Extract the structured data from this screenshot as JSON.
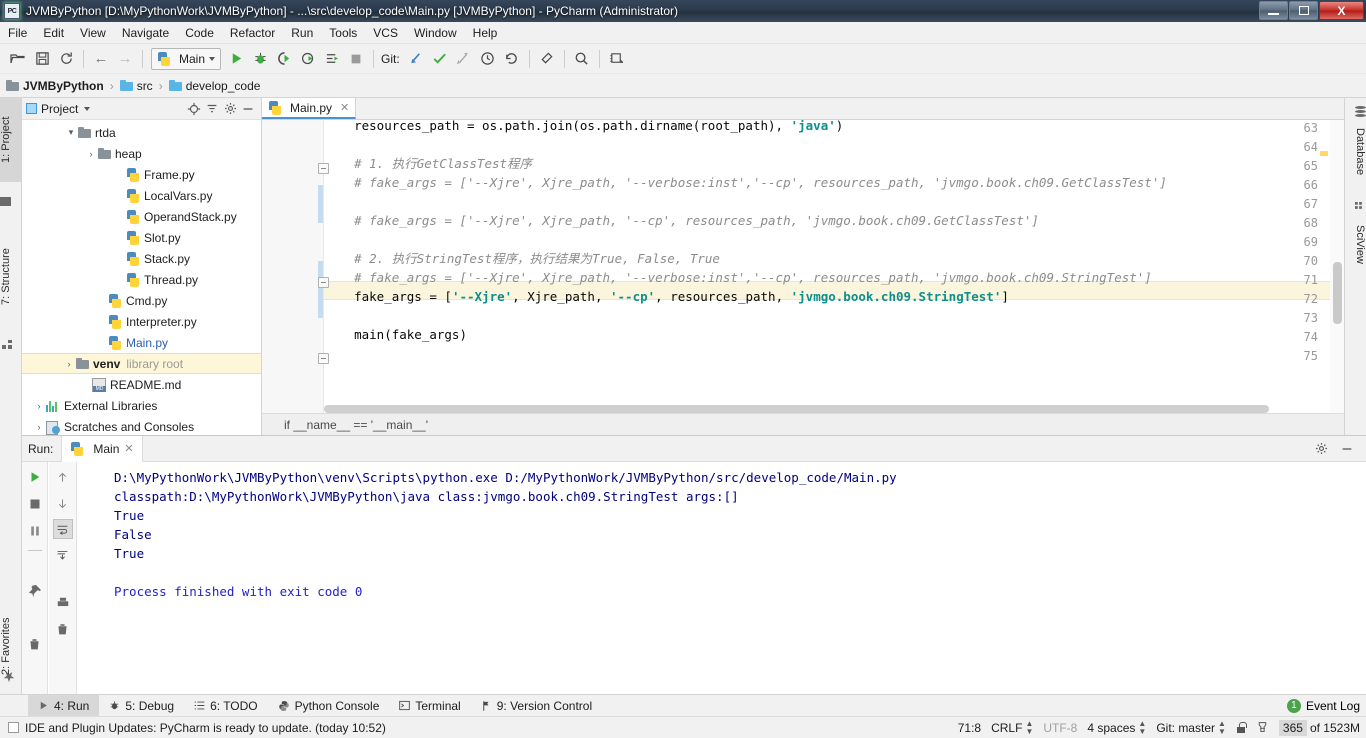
{
  "window": {
    "title": "JVMByPython [D:\\MyPythonWork\\JVMByPython] - ...\\src\\develop_code\\Main.py [JVMByPython] - PyCharm (Administrator)",
    "app_icon": "PC",
    "minimize": "–",
    "maximize": "❐",
    "close": "✕"
  },
  "menu": {
    "items": [
      "File",
      "Edit",
      "View",
      "Navigate",
      "Code",
      "Refactor",
      "Run",
      "Tools",
      "VCS",
      "Window",
      "Help"
    ]
  },
  "toolbar": {
    "open_label": "open-folder-icon",
    "save_label": "save-icon",
    "sync_label": "sync-icon",
    "back_label": "←",
    "forward_label": "→",
    "run_config": "Main",
    "run_label": "run-icon",
    "debug_label": "debug-icon",
    "coverage_label": "coverage-icon",
    "profile_label": "profile-icon",
    "rerun_label": "rerun-icon",
    "stop_label": "stop-icon",
    "git_label": "Git:",
    "update_label": "update-project-icon",
    "commit_label": "commit-icon",
    "push_label": "push-icon",
    "history_label": "history-icon",
    "revert_label": "revert-icon",
    "settings_label": "settings-icon",
    "search_label": "search-icon",
    "sdk_label": "sdk-icon"
  },
  "breadcrumb": {
    "items": [
      {
        "label": "JVMByPython",
        "kind": "project"
      },
      {
        "label": "src",
        "kind": "folder"
      },
      {
        "label": "develop_code",
        "kind": "folder"
      }
    ],
    "separator": "›"
  },
  "left_tool_strip": {
    "tabs": [
      {
        "label": "1: Project",
        "active": true
      },
      {
        "label": "7: Structure",
        "active": false
      },
      {
        "label": "2: Favorites",
        "active": false
      }
    ]
  },
  "right_tool_strip": {
    "tabs": [
      {
        "label": "Database"
      },
      {
        "label": "SciView"
      }
    ]
  },
  "project_panel": {
    "title": "Project",
    "buttons": [
      "locate-icon",
      "collapse-all-icon",
      "gear-icon",
      "hide-icon"
    ],
    "tree": [
      {
        "indent": 3,
        "arrow": "⌄",
        "icon": "folder",
        "label": "rtda",
        "selected": false
      },
      {
        "indent": 4,
        "arrow": "›",
        "icon": "folder",
        "label": "heap",
        "selected": false
      },
      {
        "indent": 5,
        "arrow": "",
        "icon": "python",
        "label": "Frame.py",
        "selected": false
      },
      {
        "indent": 5,
        "arrow": "",
        "icon": "python",
        "label": "LocalVars.py",
        "selected": false
      },
      {
        "indent": 5,
        "arrow": "",
        "icon": "python",
        "label": "OperandStack.py",
        "selected": false
      },
      {
        "indent": 5,
        "arrow": "",
        "icon": "python",
        "label": "Slot.py",
        "selected": false
      },
      {
        "indent": 5,
        "arrow": "",
        "icon": "python",
        "label": "Stack.py",
        "selected": false
      },
      {
        "indent": 5,
        "arrow": "",
        "icon": "python",
        "label": "Thread.py",
        "selected": false
      },
      {
        "indent": 4,
        "arrow": "",
        "icon": "python",
        "label": "Cmd.py",
        "selected": false
      },
      {
        "indent": 4,
        "arrow": "",
        "icon": "python",
        "label": "Interpreter.py",
        "selected": false
      },
      {
        "indent": 4,
        "arrow": "",
        "icon": "python",
        "label": "Main.py",
        "selected": false,
        "blue": true
      },
      {
        "indent": 2,
        "arrow": "›",
        "icon": "folder",
        "label": "venv",
        "suffix": "library root",
        "selected": true,
        "bold": true
      },
      {
        "indent": 3,
        "arrow": "",
        "icon": "md",
        "label": "README.md",
        "selected": false
      },
      {
        "indent": 1,
        "arrow": "›",
        "icon": "lib",
        "label": "External Libraries",
        "selected": false
      },
      {
        "indent": 1,
        "arrow": "›",
        "icon": "scratch",
        "label": "Scratches and Consoles",
        "selected": false
      }
    ]
  },
  "editor": {
    "tab": {
      "label": "Main.py",
      "close": "✕",
      "icon": "python-file-icon"
    },
    "first_visible_line": 63,
    "lines": [
      {
        "n": 63,
        "fold": false,
        "clipped": true,
        "tokens": [
          {
            "t": "    resources_path = os.path.join(os.path.dirname(root_path), ",
            "c": "plain"
          },
          {
            "t": "'java'",
            "c": "str"
          },
          {
            "t": ")",
            "c": "plain"
          }
        ]
      },
      {
        "n": 64,
        "fold": false,
        "tokens": []
      },
      {
        "n": 65,
        "fold": true,
        "tokens": [
          {
            "t": "    # 1. 执行GetClassTest程序",
            "c": "cmt"
          }
        ]
      },
      {
        "n": 66,
        "fold": false,
        "tokens": [
          {
            "t": "    # fake_args = ['--Xjre', Xjre_path, '--verbose:inst','--cp', resources_path, 'jvmgo.book.ch09.GetClassTest']",
            "c": "cmt"
          }
        ]
      },
      {
        "n": 67,
        "fold": false,
        "tokens": []
      },
      {
        "n": 68,
        "fold": false,
        "tokens": [
          {
            "t": "    # fake_args = ['--Xjre', Xjre_path, '--cp', resources_path, 'jvmgo.book.ch09.GetClassTest']",
            "c": "cmt"
          }
        ]
      },
      {
        "n": 69,
        "fold": false,
        "tokens": []
      },
      {
        "n": 70,
        "fold": false,
        "tokens": [
          {
            "t": "    # 2. 执行StringTest程序，执行结果为True, False, True",
            "c": "cmt"
          }
        ]
      },
      {
        "n": 71,
        "fold": true,
        "highlight": true,
        "tokens": [
          {
            "t": "    # fake_args = ['--Xjre', Xjre_path, '--verbose:inst','--cp', resources_path, 'jvmgo.book.ch09.StringTest']",
            "c": "cmt"
          }
        ]
      },
      {
        "n": 72,
        "fold": false,
        "tokens": [
          {
            "t": "    fake_args = [",
            "c": "plain"
          },
          {
            "t": "'--Xjre'",
            "c": "str"
          },
          {
            "t": ", Xjre_path, ",
            "c": "plain"
          },
          {
            "t": "'--cp'",
            "c": "str"
          },
          {
            "t": ", resources_path, ",
            "c": "plain"
          },
          {
            "t": "'jvmgo.book.ch09.StringTest'",
            "c": "str"
          },
          {
            "t": "]",
            "c": "plain"
          }
        ]
      },
      {
        "n": 73,
        "fold": false,
        "tokens": []
      },
      {
        "n": 74,
        "fold": true,
        "tokens": [
          {
            "t": "    main(fake_args)",
            "c": "plain"
          }
        ]
      },
      {
        "n": 75,
        "fold": false,
        "tokens": []
      }
    ],
    "code_breadcrumb": "if __name__ == '__main__'"
  },
  "run_panel": {
    "label": "Run:",
    "tab": {
      "label": "Main",
      "close": "✕"
    },
    "header_buttons": [
      "gear-icon",
      "hide-icon"
    ],
    "side_buttons_col1": [
      "rerun-icon",
      "stop-icon",
      "pause-icon"
    ],
    "side_buttons_col2": [
      "up-icon",
      "down-icon",
      "soft-wrap-icon",
      "scroll-to-end-icon",
      "print-icon",
      "trash-icon",
      "pin-icon"
    ],
    "console_lines": [
      {
        "text": "D:\\MyPythonWork\\JVMByPython\\venv\\Scripts\\python.exe D:/MyPythonWork/JVMByPython/src/develop_code/Main.py",
        "style": "out"
      },
      {
        "text": "classpath:D:\\MyPythonWork\\JVMByPython\\java class:jvmgo.book.ch09.StringTest args:[]",
        "style": "out"
      },
      {
        "text": "True",
        "style": "out"
      },
      {
        "text": "False",
        "style": "out"
      },
      {
        "text": "True",
        "style": "out"
      },
      {
        "text": "",
        "style": "out"
      },
      {
        "text": "Process finished with exit code 0",
        "style": "red"
      }
    ]
  },
  "bottom_tabs": {
    "tabs": [
      {
        "label": "4: Run",
        "icon": "run-icon",
        "active": true
      },
      {
        "label": "5: Debug",
        "icon": "debug-icon",
        "active": false
      },
      {
        "label": "6: TODO",
        "icon": "todo-icon",
        "active": false
      },
      {
        "label": "Python Console",
        "icon": "python-console-icon",
        "active": false
      },
      {
        "label": "Terminal",
        "icon": "terminal-icon",
        "active": false
      },
      {
        "label": "9: Version Control",
        "icon": "vcs-icon",
        "active": false
      }
    ],
    "event_log": {
      "label": "Event Log",
      "count": "1"
    }
  },
  "statusbar": {
    "message": "IDE and Plugin Updates: PyCharm is ready to update. (today 10:52)",
    "caret_position": "71:8",
    "line_separator": "CRLF",
    "encoding": "UTF-8",
    "indent": "4 spaces",
    "git_branch": "Git: master",
    "lock": "lock-icon",
    "inspection": "inspection-icon",
    "memory": "365",
    "memory_total": "of 1523M"
  }
}
